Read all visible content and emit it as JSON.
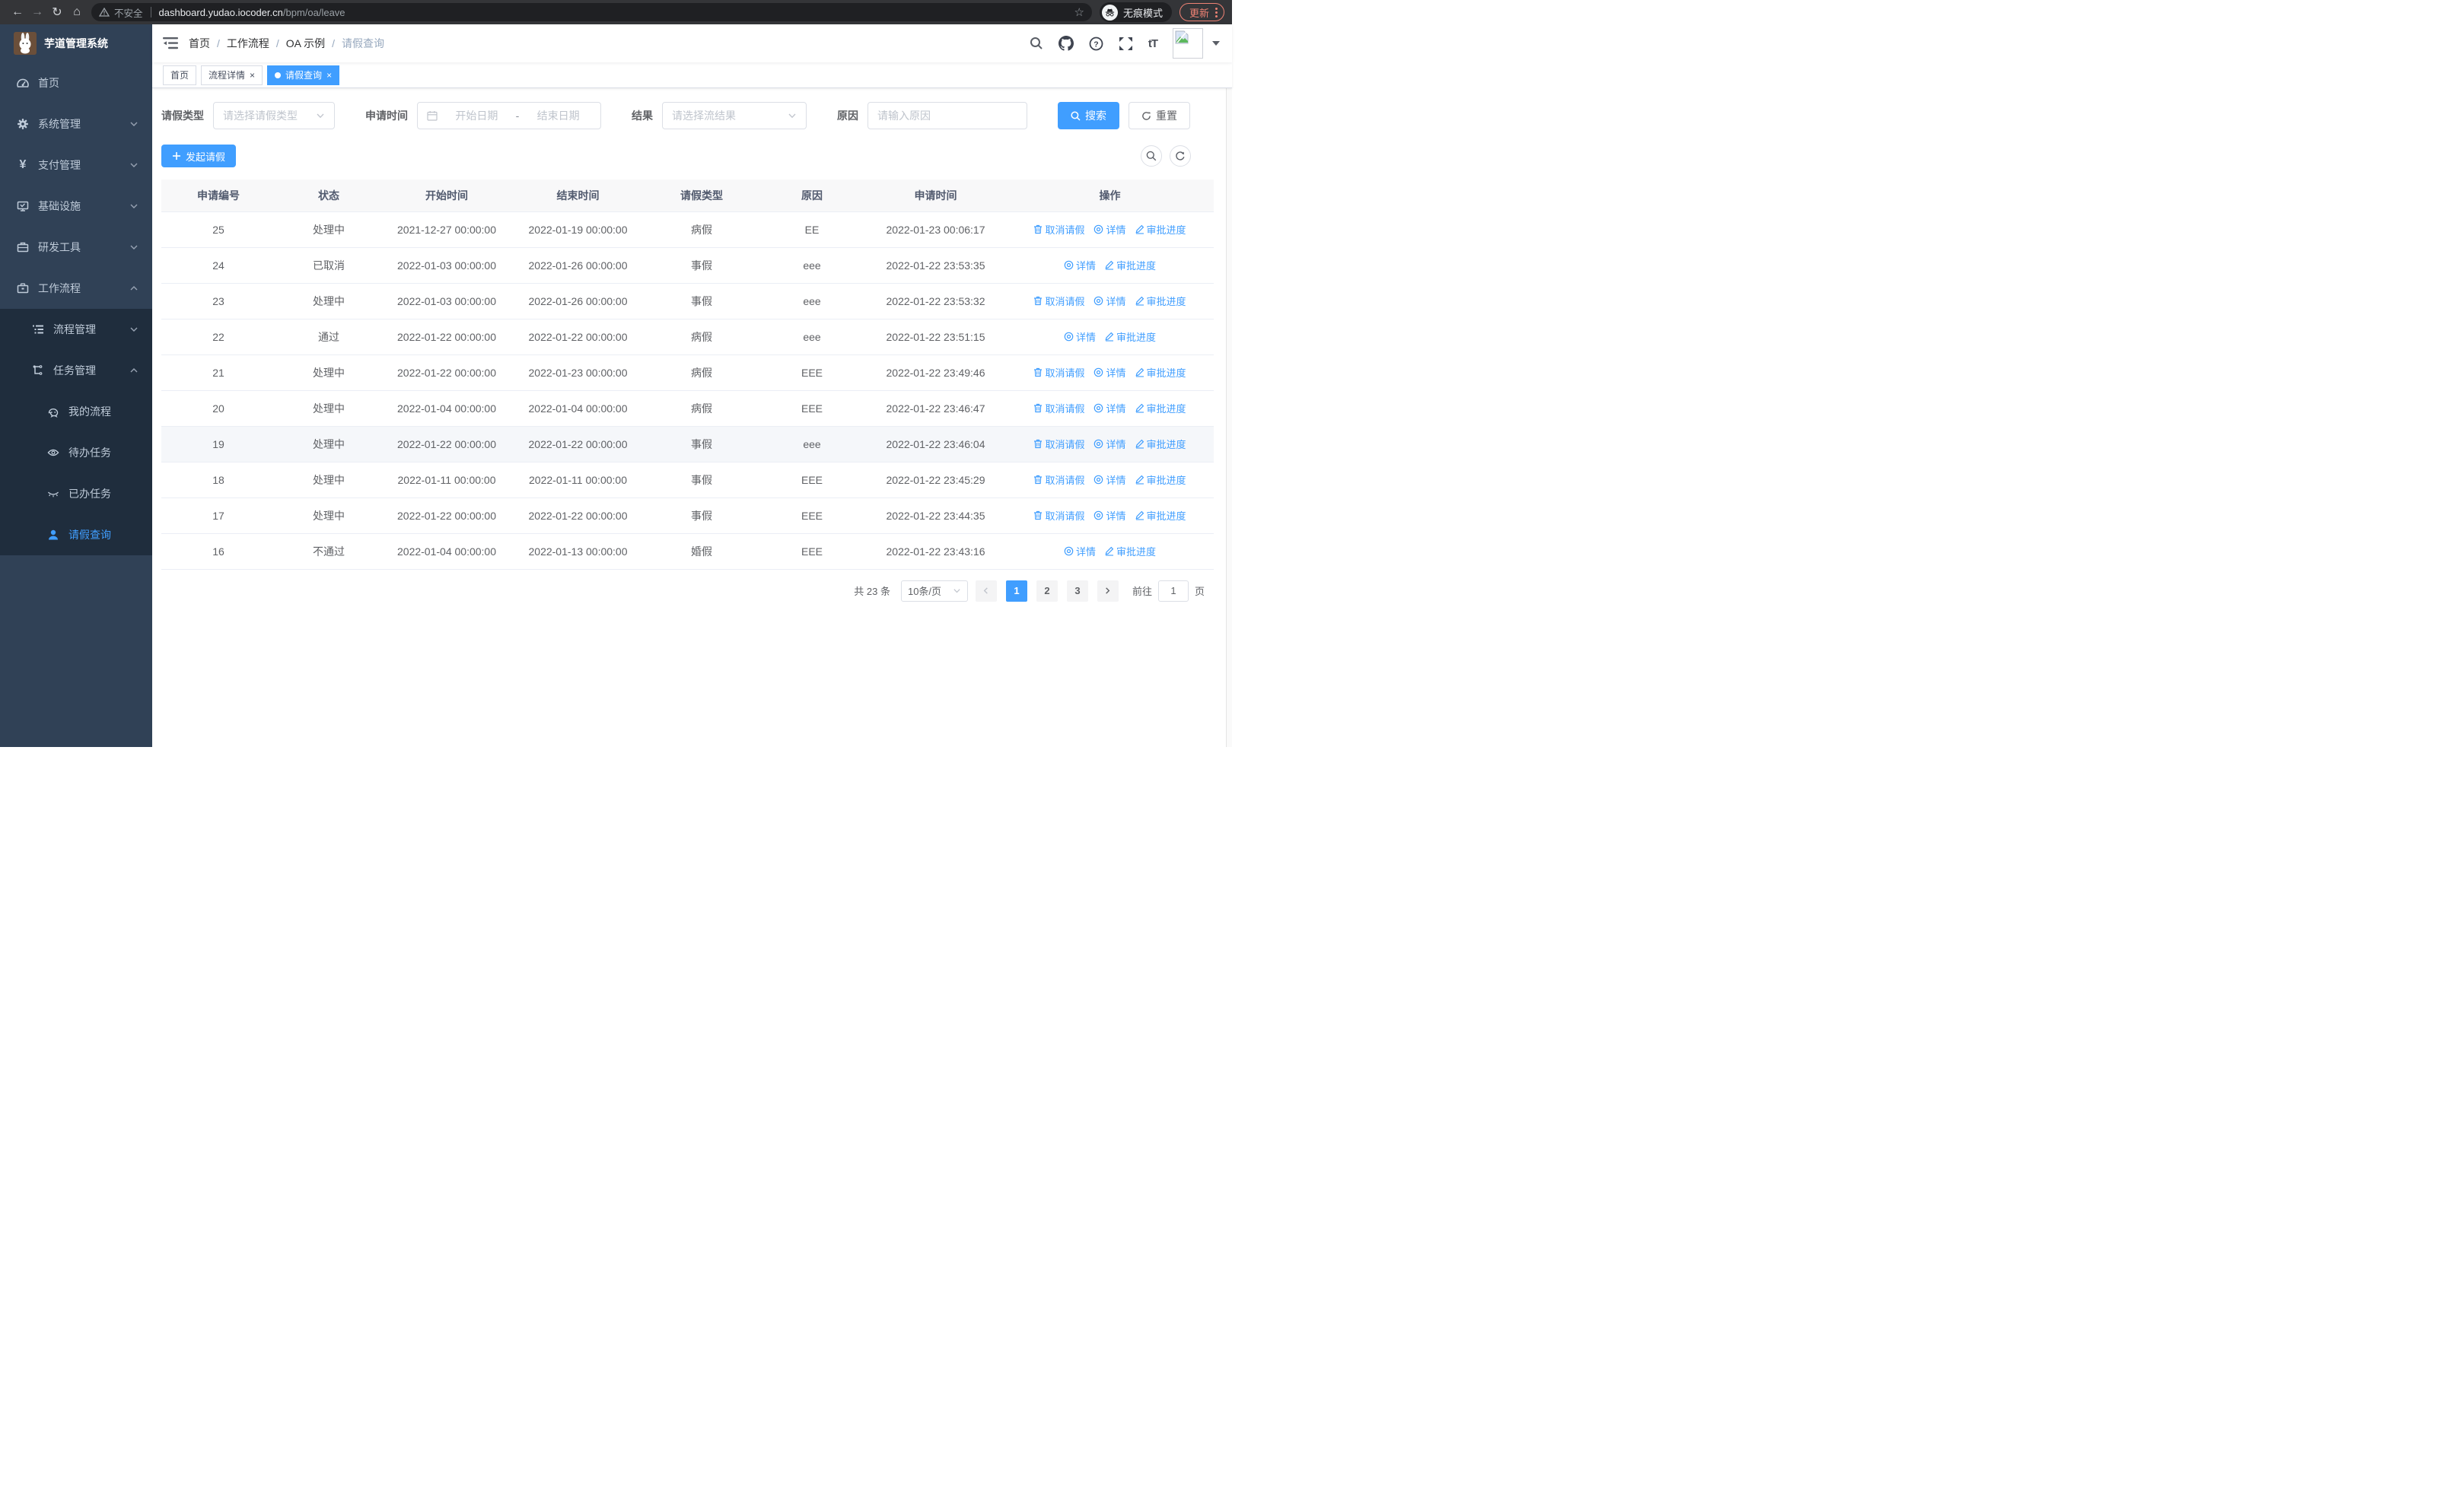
{
  "browser": {
    "security_warning": "不安全",
    "url_host": "dashboard.yudao.iocoder.cn",
    "url_path": "/bpm/oa/leave",
    "incognito_label": "无痕模式",
    "update_button": "更新"
  },
  "icons": {
    "back": "←",
    "forward": "→",
    "reload": "↻",
    "home": "⌂",
    "star": "☆",
    "close": "×",
    "font_size": "tT",
    "yen": "¥"
  },
  "sidebar": {
    "logo_title": "芋道管理系统",
    "items": [
      {
        "label": "首页",
        "icon": "dashboard-icon"
      },
      {
        "label": "系统管理",
        "icon": "gear-icon"
      },
      {
        "label": "支付管理",
        "icon": "yen-icon"
      },
      {
        "label": "基础设施",
        "icon": "monitor-icon"
      },
      {
        "label": "研发工具",
        "icon": "toolbox-icon"
      },
      {
        "label": "工作流程",
        "icon": "briefcase-icon",
        "expanded": true,
        "children": [
          {
            "label": "流程管理",
            "icon": "tree-table-icon"
          },
          {
            "label": "任务管理",
            "icon": "sitemap-icon",
            "expanded": true,
            "children": [
              {
                "label": "我的流程",
                "icon": "robot-icon"
              },
              {
                "label": "待办任务",
                "icon": "eye-open-icon"
              },
              {
                "label": "已办任务",
                "icon": "eye-closed-icon"
              },
              {
                "label": "请假查询",
                "icon": "user-icon",
                "active": true
              }
            ]
          }
        ]
      }
    ]
  },
  "breadcrumb": {
    "separator": "/",
    "items": [
      "首页",
      "工作流程",
      "OA 示例",
      "请假查询"
    ]
  },
  "tabs": [
    {
      "label": "首页",
      "closable": false,
      "active": false
    },
    {
      "label": "流程详情",
      "closable": true,
      "active": false
    },
    {
      "label": "请假查询",
      "closable": true,
      "active": true
    }
  ],
  "filters": {
    "leave_type_label": "请假类型",
    "leave_type_placeholder": "请选择请假类型",
    "apply_time_label": "申请时间",
    "start_date_placeholder": "开始日期",
    "range_separator": "-",
    "end_date_placeholder": "结束日期",
    "result_label": "结果",
    "result_placeholder": "请选择流结果",
    "reason_label": "原因",
    "reason_placeholder": "请输入原因",
    "search_button": "搜索",
    "reset_button": "重置"
  },
  "toolbar": {
    "create_button": "发起请假"
  },
  "table": {
    "columns": [
      "申请编号",
      "状态",
      "开始时间",
      "结束时间",
      "请假类型",
      "原因",
      "申请时间",
      "操作"
    ],
    "action_labels": {
      "cancel": "取消请假",
      "detail": "详情",
      "progress": "审批进度"
    },
    "rows": [
      {
        "id": "25",
        "status": "处理中",
        "start": "2021-12-27 00:00:00",
        "end": "2022-01-19 00:00:00",
        "type": "病假",
        "reason": "EE",
        "apply_time": "2022-01-23 00:06:17",
        "can_cancel": true,
        "highlight": false
      },
      {
        "id": "24",
        "status": "已取消",
        "start": "2022-01-03 00:00:00",
        "end": "2022-01-26 00:00:00",
        "type": "事假",
        "reason": "eee",
        "apply_time": "2022-01-22 23:53:35",
        "can_cancel": false,
        "highlight": false
      },
      {
        "id": "23",
        "status": "处理中",
        "start": "2022-01-03 00:00:00",
        "end": "2022-01-26 00:00:00",
        "type": "事假",
        "reason": "eee",
        "apply_time": "2022-01-22 23:53:32",
        "can_cancel": true,
        "highlight": false
      },
      {
        "id": "22",
        "status": "通过",
        "start": "2022-01-22 00:00:00",
        "end": "2022-01-22 00:00:00",
        "type": "病假",
        "reason": "eee",
        "apply_time": "2022-01-22 23:51:15",
        "can_cancel": false,
        "highlight": false
      },
      {
        "id": "21",
        "status": "处理中",
        "start": "2022-01-22 00:00:00",
        "end": "2022-01-23 00:00:00",
        "type": "病假",
        "reason": "EEE",
        "apply_time": "2022-01-22 23:49:46",
        "can_cancel": true,
        "highlight": false
      },
      {
        "id": "20",
        "status": "处理中",
        "start": "2022-01-04 00:00:00",
        "end": "2022-01-04 00:00:00",
        "type": "病假",
        "reason": "EEE",
        "apply_time": "2022-01-22 23:46:47",
        "can_cancel": true,
        "highlight": false
      },
      {
        "id": "19",
        "status": "处理中",
        "start": "2022-01-22 00:00:00",
        "end": "2022-01-22 00:00:00",
        "type": "事假",
        "reason": "eee",
        "apply_time": "2022-01-22 23:46:04",
        "can_cancel": true,
        "highlight": true
      },
      {
        "id": "18",
        "status": "处理中",
        "start": "2022-01-11 00:00:00",
        "end": "2022-01-11 00:00:00",
        "type": "事假",
        "reason": "EEE",
        "apply_time": "2022-01-22 23:45:29",
        "can_cancel": true,
        "highlight": false
      },
      {
        "id": "17",
        "status": "处理中",
        "start": "2022-01-22 00:00:00",
        "end": "2022-01-22 00:00:00",
        "type": "事假",
        "reason": "EEE",
        "apply_time": "2022-01-22 23:44:35",
        "can_cancel": true,
        "highlight": false
      },
      {
        "id": "16",
        "status": "不通过",
        "start": "2022-01-04 00:00:00",
        "end": "2022-01-13 00:00:00",
        "type": "婚假",
        "reason": "EEE",
        "apply_time": "2022-01-22 23:43:16",
        "can_cancel": false,
        "highlight": false
      }
    ]
  },
  "pagination": {
    "total_text": "共 23 条",
    "page_size": "10条/页",
    "pages": [
      "1",
      "2",
      "3"
    ],
    "active_page": "1",
    "goto_label": "前往",
    "goto_value": "1",
    "goto_suffix": "页"
  },
  "colors": {
    "accent": "#409eff",
    "sidebar": "#304156",
    "submenu": "#1f2d3d",
    "update_chip": "#ee8274"
  }
}
